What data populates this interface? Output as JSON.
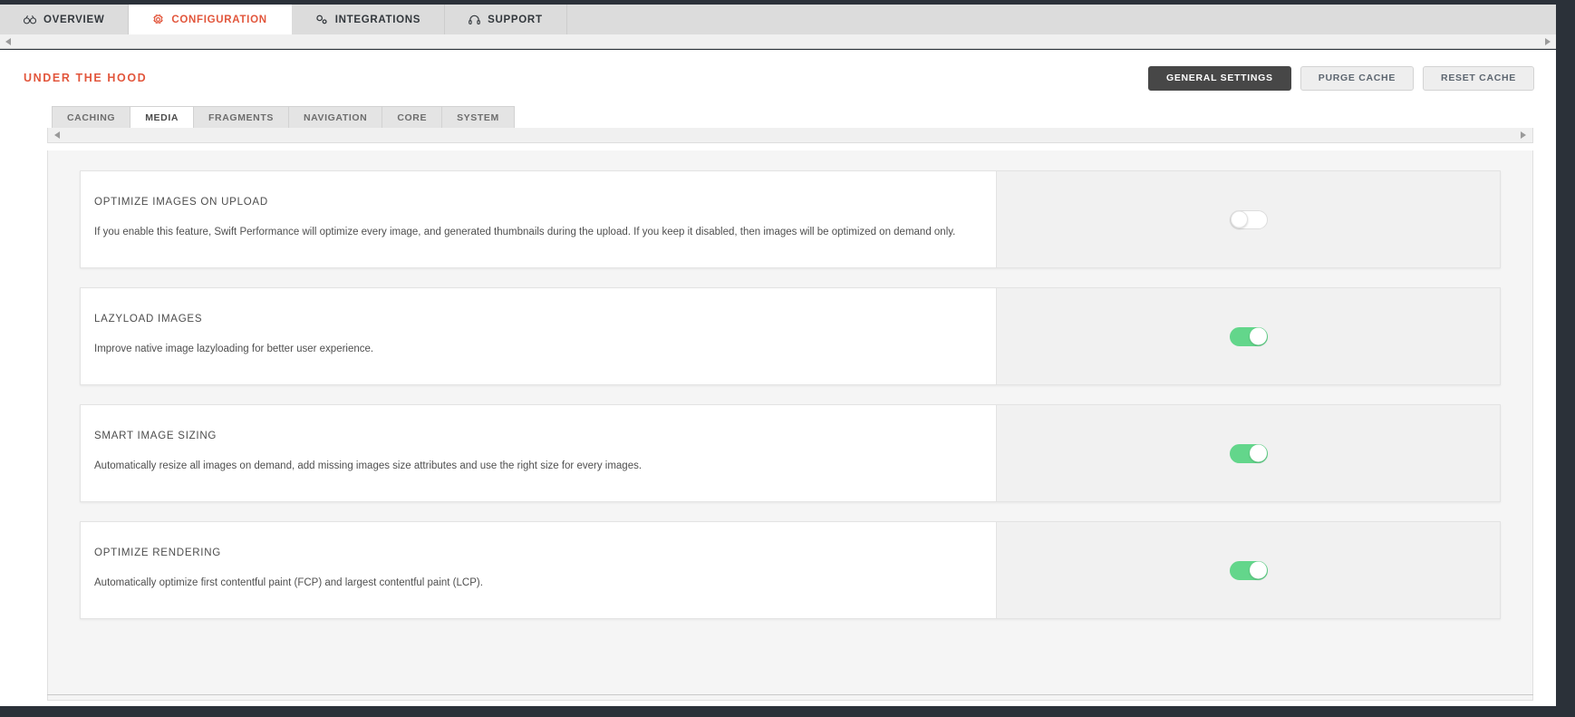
{
  "top_nav": {
    "tabs": [
      {
        "label": "OVERVIEW",
        "icon": "binoculars-icon",
        "active": false
      },
      {
        "label": "CONFIGURATION",
        "icon": "gear-icon",
        "active": true
      },
      {
        "label": "INTEGRATIONS",
        "icon": "plugin-icon",
        "active": false
      },
      {
        "label": "SUPPORT",
        "icon": "headset-icon",
        "active": false
      }
    ]
  },
  "header": {
    "title": "UNDER THE HOOD",
    "buttons": [
      {
        "label": "GENERAL SETTINGS",
        "style": "dark"
      },
      {
        "label": "PURGE CACHE",
        "style": "light"
      },
      {
        "label": "RESET CACHE",
        "style": "light"
      }
    ]
  },
  "sub_tabs": [
    {
      "label": "CACHING",
      "active": false
    },
    {
      "label": "MEDIA",
      "active": true
    },
    {
      "label": "FRAGMENTS",
      "active": false
    },
    {
      "label": "NAVIGATION",
      "active": false
    },
    {
      "label": "CORE",
      "active": false
    },
    {
      "label": "SYSTEM",
      "active": false
    }
  ],
  "scroll_controls": {
    "left_arrow": "scroll-left-icon",
    "right_arrow": "scroll-right-icon"
  },
  "settings": [
    {
      "title": "OPTIMIZE IMAGES ON UPLOAD",
      "description": "If you enable this feature, Swift Performance will optimize every image, and generated thumbnails during the upload. If you keep it disabled, then images will be optimized on demand only.",
      "enabled": false
    },
    {
      "title": "LAZYLOAD IMAGES",
      "description": "Improve native image lazyloading for better user experience.",
      "enabled": true
    },
    {
      "title": "SMART IMAGE SIZING",
      "description": "Automatically resize all images on demand, add missing images size attributes and use the right size for every images.",
      "enabled": true
    },
    {
      "title": "OPTIMIZE RENDERING",
      "description": "Automatically optimize first contentful paint (FCP) and largest contentful paint (LCP).",
      "enabled": true
    }
  ],
  "colors": {
    "accent": "#e2563c",
    "toggle_on": "#63d68b",
    "dark_button": "#474747",
    "chrome": "#2b3139"
  }
}
